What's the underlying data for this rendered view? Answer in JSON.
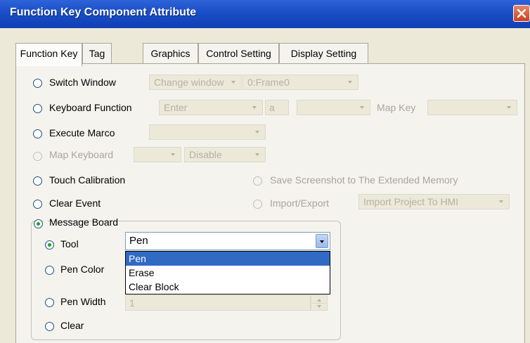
{
  "window": {
    "title": "Function Key Component Attribute"
  },
  "tabs": [
    {
      "label": "Function Key"
    },
    {
      "label": "Tag"
    },
    {
      "label": "Graphics"
    },
    {
      "label": "Control Setting"
    },
    {
      "label": "Display Setting"
    }
  ],
  "options": {
    "switch_window": {
      "label": "Switch Window",
      "combo1": "Change window",
      "combo2": "0:Frame0"
    },
    "keyboard_function": {
      "label": "Keyboard Function",
      "combo1": "Enter",
      "text": "a",
      "combo2": "",
      "map_key_label": "Map Key",
      "map_key_value": ""
    },
    "execute_macro": {
      "label": "Execute Marco",
      "combo": ""
    },
    "map_keyboard": {
      "label": "Map Keyboard",
      "combo1": "",
      "combo2": "Disable"
    },
    "touch_calibration": {
      "label": "Touch Calibration"
    },
    "save_screenshot": {
      "label": "Save Screenshot to The Extended Memory"
    },
    "clear_event": {
      "label": "Clear Event"
    },
    "import_export": {
      "label": "Import/Export",
      "combo": "Import Project To HMI"
    },
    "message_board": {
      "label": "Message Board"
    }
  },
  "message_board": {
    "tool": {
      "label": "Tool",
      "value": "Pen"
    },
    "pen_color": {
      "label": "Pen Color"
    },
    "pen_width": {
      "label": "Pen Width",
      "value": "1"
    },
    "clear": {
      "label": "Clear"
    },
    "dropdown_options": [
      "Pen",
      "Erase",
      "Clear Block"
    ]
  },
  "colors": {
    "title_bar": "#1b50c8",
    "selection": "#316ac5",
    "close_button": "#c8401e"
  }
}
